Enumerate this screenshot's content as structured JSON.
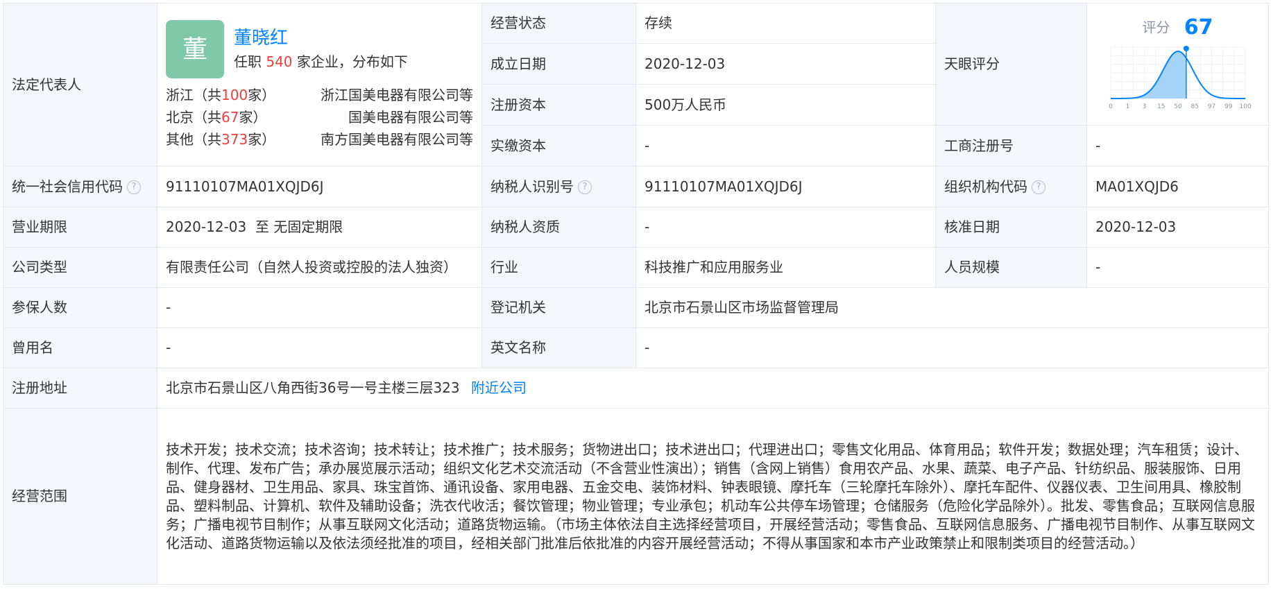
{
  "legal_rep": {
    "label": "法定代表人",
    "avatar_char": "董",
    "name": "董晓红",
    "office_prefix": "任职",
    "office_count": "540",
    "office_suffix": "家企业，分布如下",
    "distribution": [
      {
        "region_prefix": "浙江（共",
        "count": "100",
        "region_suffix": "家）",
        "company": "浙江国美电器有限公司等"
      },
      {
        "region_prefix": "北京（共",
        "count": "67",
        "region_suffix": "家）",
        "company": "国美电器有限公司等"
      },
      {
        "region_prefix": "其他（共",
        "count": "373",
        "region_suffix": "家）",
        "company": "南方国美电器有限公司等"
      }
    ]
  },
  "business_status": {
    "label": "经营状态",
    "value": "存续"
  },
  "established": {
    "label": "成立日期",
    "value": "2020-12-03"
  },
  "registered_capital": {
    "label": "注册资本",
    "value": "500万人民币"
  },
  "paid_capital": {
    "label": "实缴资本",
    "value": "-"
  },
  "tianyan": {
    "label": "天眼评分",
    "score_label": "评分",
    "score": 67,
    "axis_ticks": [
      "0",
      "1",
      "3",
      "15",
      "50",
      "85",
      "97",
      "99",
      "100"
    ],
    "accent": "#0084ff"
  },
  "reg_number": {
    "label": "工商注册号",
    "value": "-"
  },
  "credit_code": {
    "label": "统一社会信用代码",
    "value": "91110107MA01XQJD6J"
  },
  "taxpayer_id": {
    "label": "纳税人识别号",
    "value": "91110107MA01XQJD6J"
  },
  "org_code": {
    "label": "组织机构代码",
    "value": "MA01XQJD6"
  },
  "term": {
    "label": "营业期限",
    "value": "2020-12-03  至 无固定期限"
  },
  "taxpayer_qual": {
    "label": "纳税人资质",
    "value": "-"
  },
  "approval_date": {
    "label": "核准日期",
    "value": "2020-12-03"
  },
  "company_type": {
    "label": "公司类型",
    "value": "有限责任公司（自然人投资或控股的法人独资）"
  },
  "industry": {
    "label": "行业",
    "value": "科技推广和应用服务业"
  },
  "staff_size": {
    "label": "人员规模",
    "value": "-"
  },
  "insured": {
    "label": "参保人数",
    "value": "-"
  },
  "reg_authority": {
    "label": "登记机关",
    "value": "北京市石景山区市场监督管理局"
  },
  "former_name": {
    "label": "曾用名",
    "value": "-"
  },
  "english_name": {
    "label": "英文名称",
    "value": "-"
  },
  "address": {
    "label": "注册地址",
    "value": "北京市石景山区八角西街36号一号主楼三层323",
    "nearby_link": "附近公司"
  },
  "scope": {
    "label": "经营范围",
    "value": "技术开发；技术交流；技术咨询；技术转让；技术推广；技术服务；货物进出口；技术进出口；代理进出口；零售文化用品、体育用品；软件开发；数据处理；汽车租赁；设计、制作、代理、发布广告；承办展览展示活动；组织文化艺术交流活动（不含营业性演出）；销售（含网上销售）食用农产品、水果、蔬菜、电子产品、针纺织品、服装服饰、日用品、健身器材、卫生用品、家具、珠宝首饰、通讯设备、家用电器、五金交电、装饰材料、钟表眼镜、摩托车（三轮摩托车除外）、摩托车配件、仪器仪表、卫生间用具、橡胶制品、塑料制品、计算机、软件及辅助设备；洗衣代收活；餐饮管理；物业管理；专业承包；机动车公共停车场管理；仓储服务（危险化学品除外）。批发、零售食品；互联网信息服务；广播电视节目制作；从事互联网文化活动；道路货物运输。（市场主体依法自主选择经营项目，开展经营活动；零售食品、互联网信息服务、广播电视节目制作、从事互联网文化活动、道路货物运输以及依法须经批准的项目，经相关部门批准后依批准的内容开展经营活动；不得从事国家和本市产业政策禁止和限制类项目的经营活动。）"
  }
}
